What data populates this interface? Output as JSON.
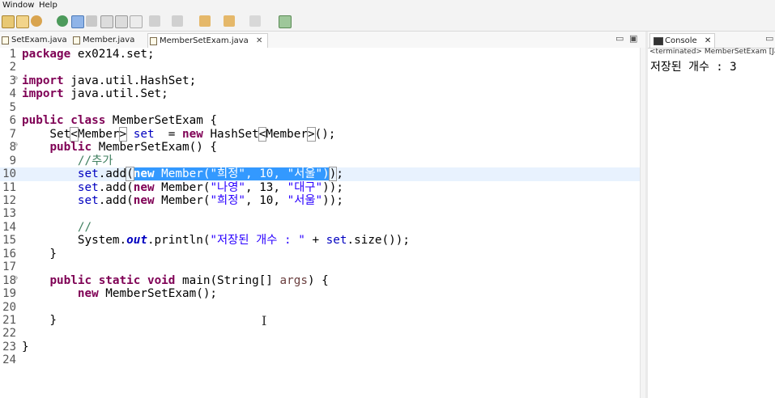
{
  "menu": [
    "Window",
    "Help"
  ],
  "editor_tabs": [
    {
      "label": "SetExam.java",
      "active": false
    },
    {
      "label": "Member.java",
      "active": false
    },
    {
      "label": "MemberSetExam.java",
      "active": true,
      "close": "✕"
    }
  ],
  "window_buttons": {
    "minimize": "▭",
    "maximize": "▣"
  },
  "code_lines": [
    {
      "n": "1",
      "text": "package ex0214.set;",
      "segs": [
        {
          "t": "package",
          "c": "kw"
        },
        {
          "t": " ex0214.set;"
        }
      ]
    },
    {
      "n": "2",
      "text": "",
      "segs": []
    },
    {
      "n": "3",
      "text": "import java.util.HashSet;",
      "fold": true,
      "segs": [
        {
          "t": "import",
          "c": "kw"
        },
        {
          "t": " java.util.HashSet;"
        }
      ]
    },
    {
      "n": "4",
      "text": "import java.util.Set;",
      "segs": [
        {
          "t": "import",
          "c": "kw"
        },
        {
          "t": " java.util.Set;"
        }
      ]
    },
    {
      "n": "5",
      "text": "",
      "segs": []
    },
    {
      "n": "6",
      "text": "public class MemberSetExam {",
      "segs": [
        {
          "t": "public",
          "c": "kw"
        },
        {
          "t": " "
        },
        {
          "t": "class",
          "c": "kw"
        },
        {
          "t": " MemberSetExam {"
        }
      ]
    },
    {
      "n": "7",
      "text": "    Set<Member> set  = new HashSet<Member>();",
      "segs": [
        {
          "t": "    Set"
        },
        {
          "t": "<",
          "c": "box"
        },
        {
          "t": "Member"
        },
        {
          "t": ">",
          "c": "box"
        },
        {
          "t": " "
        },
        {
          "t": "set",
          "c": "fld"
        },
        {
          "t": "  = "
        },
        {
          "t": "new",
          "c": "kw"
        },
        {
          "t": " HashSet"
        },
        {
          "t": "<",
          "c": "box"
        },
        {
          "t": "Member"
        },
        {
          "t": ">",
          "c": "box"
        },
        {
          "t": "();"
        }
      ]
    },
    {
      "n": "8",
      "text": "    public MemberSetExam() {",
      "fold": true,
      "segs": [
        {
          "t": "    "
        },
        {
          "t": "public",
          "c": "kw"
        },
        {
          "t": " MemberSetExam() {"
        }
      ]
    },
    {
      "n": "9",
      "text": "        //추가",
      "segs": [
        {
          "t": "        "
        },
        {
          "t": "//추가",
          "c": "cm"
        }
      ]
    },
    {
      "n": "10",
      "text": "        set.add(new Member(\"희정\", 10, \"서울\"));",
      "current": true,
      "segs": [
        {
          "t": "        "
        },
        {
          "t": "set",
          "c": "fld"
        },
        {
          "t": ".add"
        },
        {
          "t": "(",
          "c": "box"
        },
        {
          "t": "new",
          "c": "kw sel"
        },
        {
          "t": " Member(",
          "c": "sel"
        },
        {
          "t": "\"희정\"",
          "c": "str sel"
        },
        {
          "t": ", 10, ",
          "c": "sel"
        },
        {
          "t": "\"서울\"",
          "c": "str sel"
        },
        {
          "t": ")",
          "c": "sel"
        },
        {
          "t": ")",
          "c": "box"
        },
        {
          "t": ";"
        }
      ]
    },
    {
      "n": "11",
      "text": "        set.add(new Member(\"나영\", 13, \"대구\"));",
      "segs": [
        {
          "t": "        "
        },
        {
          "t": "set",
          "c": "fld"
        },
        {
          "t": ".add("
        },
        {
          "t": "new",
          "c": "kw"
        },
        {
          "t": " Member("
        },
        {
          "t": "\"나영\"",
          "c": "str"
        },
        {
          "t": ", 13, "
        },
        {
          "t": "\"대구\"",
          "c": "str"
        },
        {
          "t": "));"
        }
      ]
    },
    {
      "n": "12",
      "text": "        set.add(new Member(\"희정\", 10, \"서울\"));",
      "segs": [
        {
          "t": "        "
        },
        {
          "t": "set",
          "c": "fld"
        },
        {
          "t": ".add("
        },
        {
          "t": "new",
          "c": "kw"
        },
        {
          "t": " Member("
        },
        {
          "t": "\"희정\"",
          "c": "str"
        },
        {
          "t": ", 10, "
        },
        {
          "t": "\"서울\"",
          "c": "str"
        },
        {
          "t": "));"
        }
      ]
    },
    {
      "n": "13",
      "text": "",
      "segs": []
    },
    {
      "n": "14",
      "text": "        //",
      "segs": [
        {
          "t": "        "
        },
        {
          "t": "//",
          "c": "cm"
        }
      ]
    },
    {
      "n": "15",
      "text": "        System.out.println(\"저장된 개수 : \" + set.size());",
      "segs": [
        {
          "t": "        System."
        },
        {
          "t": "out",
          "c": "sfld"
        },
        {
          "t": ".println("
        },
        {
          "t": "\"저장된 개수 : \"",
          "c": "str"
        },
        {
          "t": " + "
        },
        {
          "t": "set",
          "c": "fld"
        },
        {
          "t": ".size());"
        }
      ]
    },
    {
      "n": "16",
      "text": "    }",
      "segs": [
        {
          "t": "    }"
        }
      ]
    },
    {
      "n": "17",
      "text": "",
      "segs": []
    },
    {
      "n": "18",
      "text": "    public static void main(String[] args) {",
      "fold": true,
      "segs": [
        {
          "t": "    "
        },
        {
          "t": "public",
          "c": "kw"
        },
        {
          "t": " "
        },
        {
          "t": "static",
          "c": "kw"
        },
        {
          "t": " "
        },
        {
          "t": "void",
          "c": "kw"
        },
        {
          "t": " main(String[] "
        },
        {
          "t": "args",
          "c": "arg"
        },
        {
          "t": ") {"
        }
      ]
    },
    {
      "n": "19",
      "text": "        new MemberSetExam();",
      "segs": [
        {
          "t": "        "
        },
        {
          "t": "new",
          "c": "kw"
        },
        {
          "t": " MemberSetExam();"
        }
      ]
    },
    {
      "n": "20",
      "text": "",
      "segs": []
    },
    {
      "n": "21",
      "text": "    }",
      "segs": [
        {
          "t": "    }"
        }
      ]
    },
    {
      "n": "22",
      "text": "",
      "segs": []
    },
    {
      "n": "23",
      "text": "}",
      "segs": [
        {
          "t": "}"
        }
      ]
    },
    {
      "n": "24",
      "text": "",
      "segs": []
    }
  ],
  "text_cursor": "I",
  "console": {
    "tab_label": "Console",
    "close": "✕",
    "status": "<terminated> MemberSetExam [Java",
    "output": "저장된 개수 : 3"
  },
  "colors": {
    "keyword": "#7f0055",
    "string": "#2a00ff",
    "comment": "#3f7f5f",
    "field": "#0000c0",
    "selection": "#3399ff",
    "current_line": "#e8f2fe"
  }
}
